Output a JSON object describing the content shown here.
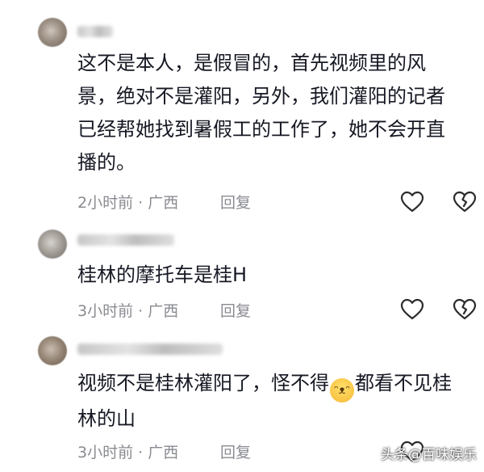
{
  "comments": [
    {
      "text": "这不是本人，是假冒的，首先视频里的风景，绝对不是灌阳，另外，我们灌阳的记者已经帮她找到暑假工的工作了，她不会开直播的。",
      "meta": "2小时前 · 广西",
      "reply_label": "回复"
    },
    {
      "text": "桂林的摩托车是桂H",
      "meta": "3小时前 · 广西",
      "reply_label": "回复"
    },
    {
      "text_before_emoji": "视频不是桂林灌阳了，怪不得",
      "emoji": "😂",
      "text_after_emoji": "都看不见桂林的山",
      "meta": "3小时前 · 广西",
      "reply_label": "回复"
    }
  ],
  "watermark": "头条@百味娱乐",
  "icons": {
    "like": "heart-outline-icon",
    "dislike": "broken-heart-icon"
  },
  "colors": {
    "text": "#161823",
    "meta": "#8a8b91",
    "icon": "#2b2b2b"
  }
}
